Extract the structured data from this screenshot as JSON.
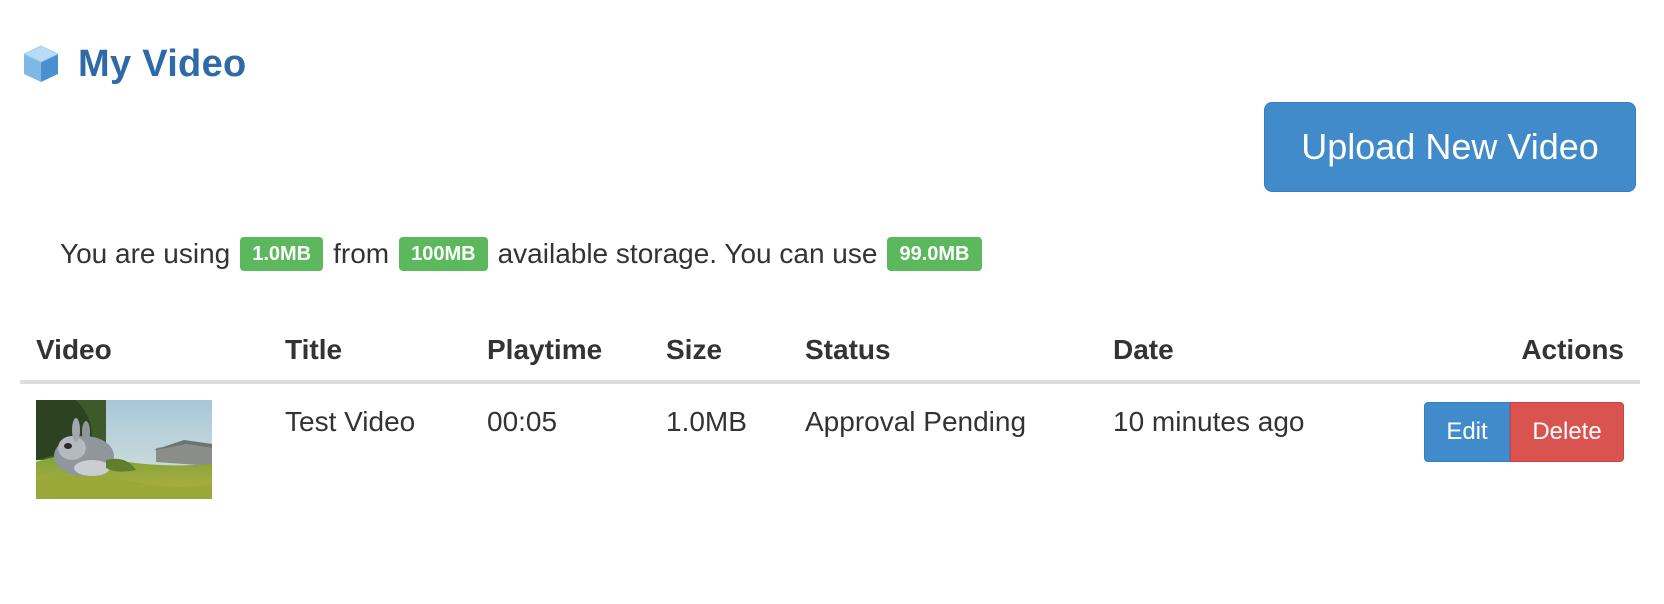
{
  "header": {
    "title": "My Video",
    "icon": "cube-icon"
  },
  "toolbar": {
    "upload_label": "Upload New Video"
  },
  "storage": {
    "prefix": "You are using",
    "used": "1.0MB",
    "middle": "from",
    "total": "100MB",
    "suffix": "available storage. You can use",
    "remaining": "99.0MB",
    "badge_color": "#5cb85c"
  },
  "table": {
    "columns": [
      "Video",
      "Title",
      "Playtime",
      "Size",
      "Status",
      "Date",
      "Actions"
    ],
    "rows": [
      {
        "title": "Test Video",
        "playtime": "00:05",
        "size": "1.0MB",
        "status": "Approval Pending",
        "date": "10 minutes ago",
        "actions": {
          "edit_label": "Edit",
          "delete_label": "Delete"
        }
      }
    ]
  },
  "colors": {
    "title": "#2f6aa8",
    "primary": "#428bca",
    "danger": "#d9534f",
    "success": "#5cb85c"
  }
}
